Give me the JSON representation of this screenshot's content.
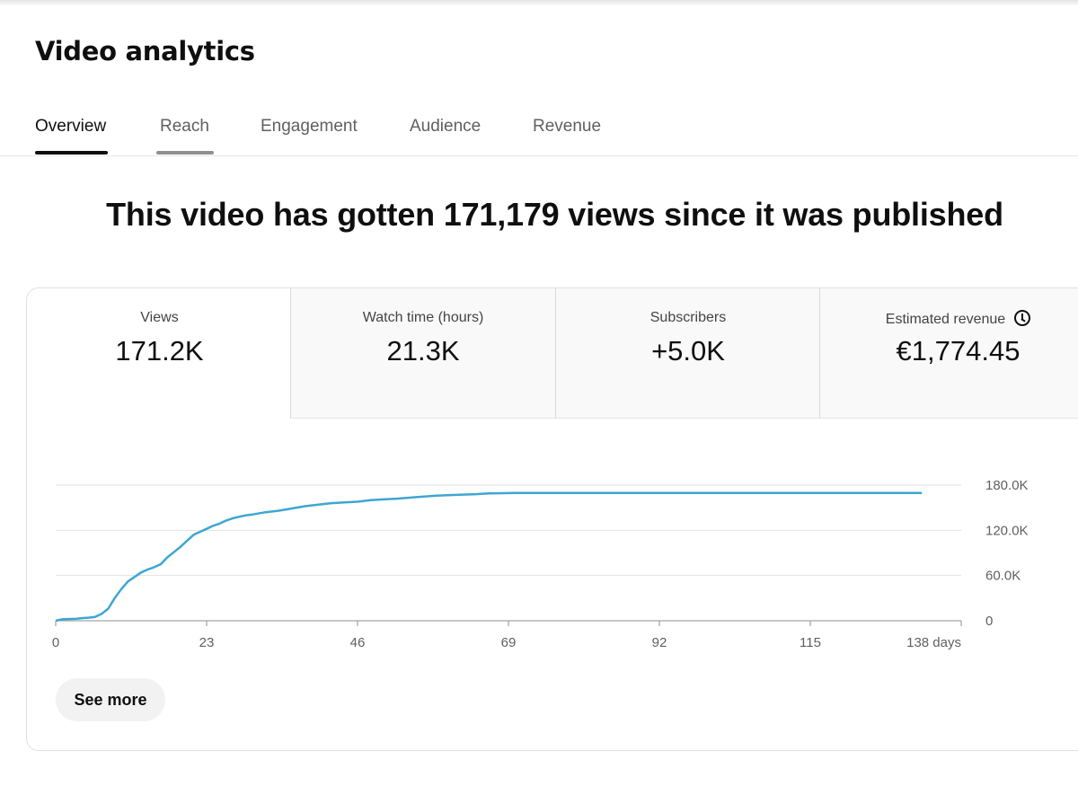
{
  "page": {
    "title": "Video analytics",
    "tabs": [
      {
        "label": "Overview",
        "active": true
      },
      {
        "label": "Reach",
        "active": false
      },
      {
        "label": "Engagement",
        "active": false
      },
      {
        "label": "Audience",
        "active": false
      },
      {
        "label": "Revenue",
        "active": false
      }
    ],
    "headline": "This video has gotten 171,179 views since it was published"
  },
  "metrics": [
    {
      "label": "Views",
      "value": "171.2K",
      "selected": true
    },
    {
      "label": "Watch time (hours)",
      "value": "21.3K",
      "selected": false
    },
    {
      "label": "Subscribers",
      "value": "+5.0K",
      "selected": false
    },
    {
      "label": "Estimated revenue",
      "value": "€1,774.45",
      "selected": false,
      "icon": "clock-icon"
    }
  ],
  "see_more_label": "See more",
  "chart_data": {
    "type": "line",
    "x_ticks": [
      "0",
      "23",
      "46",
      "69",
      "92",
      "115",
      "138 days"
    ],
    "y_ticks": [
      "0",
      "60.0K",
      "120.0K",
      "180.0K"
    ],
    "xlim": [
      0,
      138
    ],
    "ylim": [
      0,
      180000
    ],
    "grid": true,
    "series": [
      {
        "color": "#3ea6d2",
        "x": [
          0,
          1,
          3,
          4,
          5,
          6,
          7,
          8,
          9,
          10,
          11,
          12,
          13,
          14,
          15,
          16,
          17,
          18,
          19,
          20,
          21,
          22,
          23,
          24,
          25,
          26,
          27,
          28,
          29,
          30,
          32,
          34,
          36,
          38,
          40,
          42,
          44,
          46,
          48,
          50,
          52,
          55,
          58,
          61,
          64,
          66,
          70,
          80,
          100,
          120,
          132
        ],
        "y": [
          0,
          2000,
          2500,
          3500,
          4000,
          5000,
          9000,
          16000,
          30000,
          42000,
          52000,
          58000,
          64000,
          68000,
          71000,
          75000,
          84000,
          91000,
          98000,
          106000,
          114000,
          118000,
          122000,
          126000,
          129000,
          133000,
          136000,
          138000,
          140000,
          141000,
          144000,
          146000,
          149000,
          152000,
          154000,
          156000,
          157000,
          158000,
          160000,
          161000,
          162000,
          164000,
          166000,
          167000,
          168000,
          169000,
          169500,
          169500,
          169500,
          169500,
          169500
        ]
      }
    ]
  }
}
